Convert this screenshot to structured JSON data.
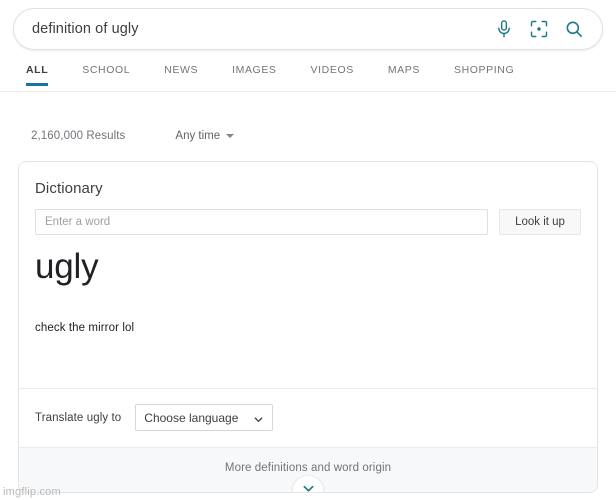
{
  "search": {
    "query": "definition of ugly",
    "icons": [
      {
        "name": "microphone-icon"
      },
      {
        "name": "lens-camera-icon"
      },
      {
        "name": "search-icon"
      }
    ],
    "icon_color": "#1c7a85"
  },
  "tabs": [
    {
      "label": "ALL",
      "active": true
    },
    {
      "label": "SCHOOL",
      "active": false
    },
    {
      "label": "NEWS",
      "active": false
    },
    {
      "label": "IMAGES",
      "active": false
    },
    {
      "label": "VIDEOS",
      "active": false
    },
    {
      "label": "MAPS",
      "active": false
    },
    {
      "label": "SHOPPING",
      "active": false
    }
  ],
  "tab_accent_color": "#1a73a7",
  "meta": {
    "result_count": "2,160,000 Results",
    "time_filter": "Any time"
  },
  "dictionary": {
    "title": "Dictionary",
    "input_placeholder": "Enter a word",
    "input_value": "",
    "lookup_button": "Look it up",
    "headword": "ugly",
    "definition": "check the mirror lol",
    "translate_label": "Translate ugly to",
    "language_selected": "Choose language",
    "more_link": "More definitions and word origin",
    "expand_icon": "chevron-down-icon"
  },
  "footer": {
    "watermark": "imgflip.com"
  }
}
